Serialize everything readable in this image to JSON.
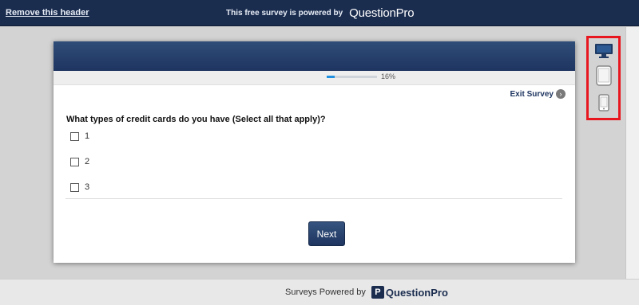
{
  "header": {
    "remove_link": "Remove this header",
    "powered_text": "This free survey is powered by",
    "brand": "QuestionPro"
  },
  "survey": {
    "progress_label": "16%",
    "progress_value": 0.16,
    "exit_label": "Exit Survey",
    "question": "What types of credit cards do you have (Select all that apply)?",
    "options": [
      "1",
      "2",
      "3"
    ],
    "next_label": "Next"
  },
  "device_selector": {
    "devices": [
      "desktop-icon",
      "tablet-icon",
      "phone-icon"
    ],
    "highlight_color": "#e8171f"
  },
  "footer": {
    "text": "Surveys Powered by",
    "badge": "P",
    "brand": "QuestionPro"
  },
  "colors": {
    "navy": "#1b2d4f",
    "accent": "#1f8fe0"
  }
}
